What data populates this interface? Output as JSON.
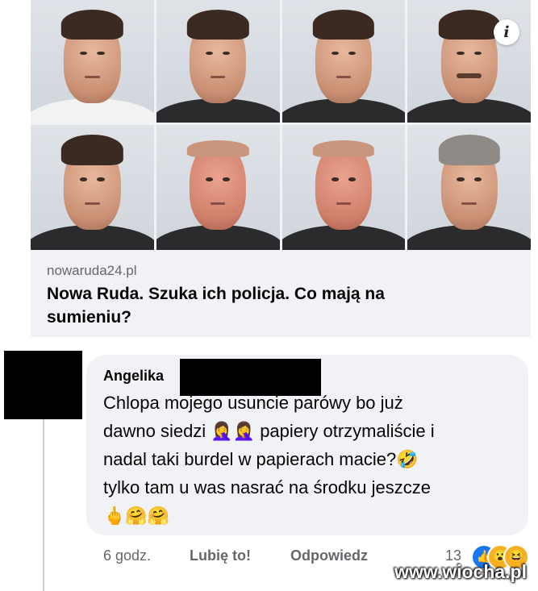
{
  "link_card": {
    "domain": "nowaruda24.pl",
    "title": "Nowa Ruda. Szuka ich policja. Co mają na sumieniu?",
    "info_icon_glyph": "i",
    "photos": [
      "mugshot-1",
      "mugshot-2",
      "mugshot-3",
      "mugshot-4",
      "mugshot-5",
      "mugshot-6",
      "mugshot-7",
      "mugshot-8"
    ]
  },
  "comment": {
    "author": "Angelika",
    "text": "Chlopa mojego usuncie parówy bo już\ndawno siedzi 🤦‍♀️🤦‍♀️ papiery otrzymaliście i\nnadal taki burdel w papierach macie?🤣\ntylko tam u was nasrać na środku jeszcze\n🖕🤗🤗",
    "time": "6 godz.",
    "like_label": "Lubię to!",
    "reply_label": "Odpowiedz",
    "reaction_count": "13",
    "reactions": [
      "like-icon",
      "wow-icon",
      "haha-icon"
    ]
  },
  "watermark": "www.wiocha.pl",
  "colors": {
    "bubble": "#f0f2f5",
    "muted_text": "#65676b",
    "like_blue": "#1877f2"
  }
}
